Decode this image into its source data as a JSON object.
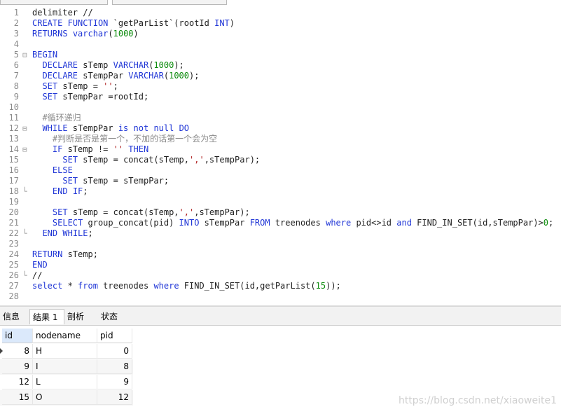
{
  "editor": {
    "lines": [
      {
        "n": "1",
        "code": "delimiter //"
      },
      {
        "n": "2",
        "code": "CREATE FUNCTION `getParList`(rootId INT)"
      },
      {
        "n": "3",
        "code": "RETURNS varchar(1000)"
      },
      {
        "n": "4",
        "code": ""
      },
      {
        "n": "5",
        "code": "BEGIN"
      },
      {
        "n": "6",
        "code": "  DECLARE sTemp VARCHAR(1000);"
      },
      {
        "n": "7",
        "code": "  DECLARE sTempPar VARCHAR(1000);"
      },
      {
        "n": "8",
        "code": "  SET sTemp = '';"
      },
      {
        "n": "9",
        "code": "  SET sTempPar =rootId;"
      },
      {
        "n": "10",
        "code": ""
      },
      {
        "n": "11",
        "code": "  #循环递归"
      },
      {
        "n": "12",
        "code": "  WHILE sTempPar is not null DO"
      },
      {
        "n": "13",
        "code": "    #判断是否是第一个，不加的话第一个会为空"
      },
      {
        "n": "14",
        "code": "    IF sTemp != '' THEN"
      },
      {
        "n": "15",
        "code": "      SET sTemp = concat(sTemp,',',sTempPar);"
      },
      {
        "n": "16",
        "code": "    ELSE"
      },
      {
        "n": "17",
        "code": "      SET sTemp = sTempPar;"
      },
      {
        "n": "18",
        "code": "    END IF;"
      },
      {
        "n": "19",
        "code": ""
      },
      {
        "n": "20",
        "code": "    SET sTemp = concat(sTemp,',',sTempPar);"
      },
      {
        "n": "21",
        "code": "    SELECT group_concat(pid) INTO sTempPar FROM treenodes where pid<>id and FIND_IN_SET(id,sTempPar)>0;"
      },
      {
        "n": "22",
        "code": "  END WHILE;"
      },
      {
        "n": "23",
        "code": ""
      },
      {
        "n": "24",
        "code": "RETURN sTemp;"
      },
      {
        "n": "25",
        "code": "END"
      },
      {
        "n": "26",
        "code": "//"
      },
      {
        "n": "27",
        "code": "select * from treenodes where FIND_IN_SET(id,getParList(15));"
      },
      {
        "n": "28",
        "code": ""
      }
    ]
  },
  "tabs": [
    {
      "label": "信息"
    },
    {
      "label": "结果 1"
    },
    {
      "label": "剖析"
    },
    {
      "label": "状态"
    }
  ],
  "result": {
    "columns": [
      "id",
      "nodename",
      "pid"
    ],
    "rows": [
      [
        "8",
        "H",
        "0"
      ],
      [
        "9",
        "I",
        "8"
      ],
      [
        "12",
        "L",
        "9"
      ],
      [
        "15",
        "O",
        "12"
      ]
    ]
  },
  "watermark": "https://blog.csdn.net/xiaoweite1",
  "colors": {
    "keyword": "#1f35d6",
    "number": "#0a8a0a",
    "string": "#b02020",
    "comment": "#8a8a8a"
  }
}
